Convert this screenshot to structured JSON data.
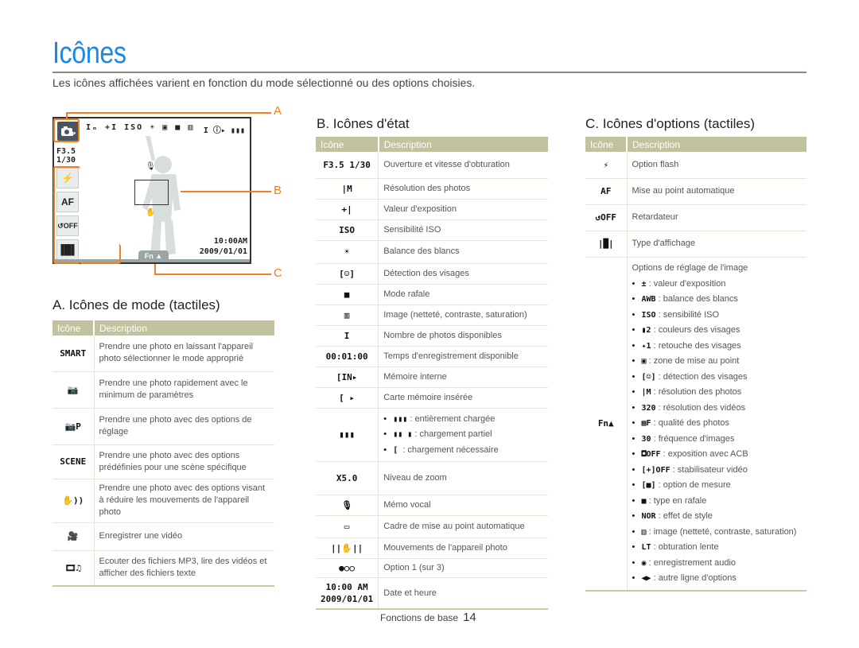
{
  "page": {
    "title": "Icônes",
    "intro": "Les icônes affichées varient en fonction du mode sélectionné ou des options choisies.",
    "footer_section": "Fonctions de base",
    "page_number": "14"
  },
  "colors": {
    "title": "#1e88e5",
    "callout": "#f08020",
    "table_header": "#c2c29e"
  },
  "camera": {
    "mode_icon": "program-mode-icon",
    "status_icons": "Iₘ +I ISO ☀ ▣ ■ ▥",
    "status_right": "I ⓘ▸ ▮▮▮",
    "aperture": "F3.5",
    "shutter": "1/30",
    "side_buttons": [
      "⚡",
      "AF",
      "↺OFF",
      "▐█▌"
    ],
    "time": "10:00AM",
    "date": "2009/01/01",
    "fn_label": "Fn ▲",
    "callouts": [
      "A",
      "B",
      "C"
    ]
  },
  "section_a": {
    "title": "A. Icônes de mode (tactiles)",
    "headers": {
      "icon": "Icône",
      "description": "Description"
    },
    "rows": [
      {
        "icon": "smart-auto-icon",
        "glyph": "SMART",
        "desc": "Prendre une photo en laissant l'appareil photo sélectionner le mode approprié"
      },
      {
        "icon": "auto-camera-icon",
        "glyph": "📷",
        "desc": "Prendre une photo rapidement avec le minimum de paramètres"
      },
      {
        "icon": "program-camera-icon",
        "glyph": "📷P",
        "desc": "Prendre une photo avec des options de réglage"
      },
      {
        "icon": "scene-icon",
        "glyph": "SCENE",
        "desc": "Prendre une photo avec des options prédéfinies pour une scène spécifique"
      },
      {
        "icon": "dual-is-icon",
        "glyph": "✋))",
        "desc": "Prendre une photo avec des options visant à réduire les mouvements de l'appareil photo"
      },
      {
        "icon": "video-camera-icon",
        "glyph": "🎥",
        "desc": "Enregistrer une vidéo"
      },
      {
        "icon": "multimedia-icon",
        "glyph": "🎞♫",
        "desc": "Ecouter des fichiers MP3, lire des vidéos et afficher des fichiers texte"
      }
    ]
  },
  "section_b": {
    "title": "B. Icônes d'état",
    "headers": {
      "icon": "Icône",
      "description": "Description"
    },
    "rows": [
      {
        "icon": "aperture-shutter-icon",
        "glyph": "F3.5 1/30",
        "desc": "Ouverture et vitesse d'obturation"
      },
      {
        "icon": "photo-resolution-icon",
        "glyph": "|M",
        "desc": "Résolution des photos"
      },
      {
        "icon": "exposure-value-icon",
        "glyph": "+|",
        "desc": "Valeur d'exposition"
      },
      {
        "icon": "iso-icon",
        "glyph": "ISO",
        "desc": "Sensibilité ISO"
      },
      {
        "icon": "white-balance-icon",
        "glyph": "☀",
        "desc": "Balance des blancs"
      },
      {
        "icon": "face-detection-icon",
        "glyph": "[☺]",
        "desc": "Détection des visages"
      },
      {
        "icon": "burst-mode-icon",
        "glyph": "■",
        "desc": "Mode rafale"
      },
      {
        "icon": "image-adjust-icon",
        "glyph": "▥",
        "desc": "Image (netteté, contraste, saturation)"
      },
      {
        "icon": "photo-count-icon",
        "glyph": "I",
        "desc": "Nombre de photos disponibles"
      },
      {
        "icon": "recording-time-icon",
        "glyph": "00:01:00",
        "desc": "Temps d'enregistrement disponible"
      },
      {
        "icon": "internal-memory-icon",
        "glyph": "[IN▸",
        "desc": "Mémoire interne"
      },
      {
        "icon": "memory-card-icon",
        "glyph": "[ ▸",
        "desc": "Carte mémoire insérée"
      },
      {
        "icon": "battery-icon",
        "glyph": "▮▮▮",
        "bullets": [
          {
            "glyph": "▮▮▮",
            "text": ": entièrement chargée"
          },
          {
            "glyph": "▮▮ ▮",
            "text": ": chargement partiel"
          },
          {
            "glyph": "[  ",
            "text": ": chargement nécessaire"
          }
        ]
      },
      {
        "icon": "zoom-level-icon",
        "glyph": "X5.0",
        "desc": "Niveau de zoom"
      },
      {
        "icon": "voice-memo-icon",
        "glyph": "🎙",
        "desc": "Mémo vocal"
      },
      {
        "icon": "af-frame-icon",
        "glyph": "▭",
        "desc": "Cadre de mise au point automatique"
      },
      {
        "icon": "camera-shake-icon",
        "glyph": "||✋||",
        "desc": "Mouvements de l'appareil photo"
      },
      {
        "icon": "option-dots-icon",
        "glyph": "●○○",
        "desc": "Option 1 (sur 3)"
      },
      {
        "icon": "date-time-icon",
        "glyph": "10:00 AM 2009/01/01",
        "desc": "Date et heure"
      }
    ]
  },
  "section_c": {
    "title": "C. Icônes d'options (tactiles)",
    "headers": {
      "icon": "Icône",
      "description": "Description"
    },
    "rows": [
      {
        "icon": "flash-icon",
        "glyph": "⚡",
        "desc": "Option flash"
      },
      {
        "icon": "autofocus-icon",
        "glyph": "AF",
        "desc": "Mise au point automatique"
      },
      {
        "icon": "timer-icon",
        "glyph": "↺OFF",
        "desc": "Retardateur"
      },
      {
        "icon": "display-type-icon",
        "glyph": "|█|",
        "desc": "Type d'affichage"
      }
    ],
    "fn_row": {
      "icon": "fn-menu-icon",
      "glyph": "Fn▲",
      "heading": "Options de réglage de l'image",
      "bullets": [
        {
          "icon": "ev-icon",
          "glyph": "±",
          "text": ": valeur d'exposition"
        },
        {
          "icon": "awb-icon",
          "glyph": "AWB",
          "text": ": balance des blancs"
        },
        {
          "icon": "iso-auto-icon",
          "glyph": "ISO",
          "text": ": sensibilité ISO"
        },
        {
          "icon": "face-tone-icon",
          "glyph": "▮2",
          "text": ": couleurs des visages"
        },
        {
          "icon": "face-retouch-icon",
          "glyph": "✦1",
          "text": ": retouche des visages"
        },
        {
          "icon": "focus-area-icon",
          "glyph": "▣",
          "text": ": zone de mise au point"
        },
        {
          "icon": "face-detect-off-icon",
          "glyph": "[☺]",
          "text": ": détection des visages"
        },
        {
          "icon": "photo-size-icon",
          "glyph": "|M",
          "text": ": résolution des photos"
        },
        {
          "icon": "video-size-icon",
          "glyph": "320",
          "text": ": résolution des vidéos"
        },
        {
          "icon": "photo-quality-icon",
          "glyph": "▦F",
          "text": ": qualité des photos"
        },
        {
          "icon": "frame-rate-icon",
          "glyph": "30",
          "text": ": fréquence d'images"
        },
        {
          "icon": "acb-icon",
          "glyph": "◘OFF",
          "text": ": exposition avec ACB"
        },
        {
          "icon": "video-stabilizer-icon",
          "glyph": "[+]OFF",
          "text": ": stabilisateur vidéo"
        },
        {
          "icon": "metering-icon",
          "glyph": "[■]",
          "text": ": option de mesure"
        },
        {
          "icon": "drive-mode-icon",
          "glyph": "■",
          "text": ": type en rafale"
        },
        {
          "icon": "photo-style-icon",
          "glyph": "NOR",
          "text": ": effet de style"
        },
        {
          "icon": "image-adjust-icon",
          "glyph": "▥",
          "text": ": image (netteté, contraste, saturation)"
        },
        {
          "icon": "long-time-icon",
          "glyph": "LT",
          "text": ": obturation lente"
        },
        {
          "icon": "voice-record-icon",
          "glyph": "◉",
          "text": ": enregistrement audio"
        },
        {
          "icon": "more-options-icon",
          "glyph": "◀▶",
          "text": ": autre ligne d'options"
        }
      ]
    }
  }
}
